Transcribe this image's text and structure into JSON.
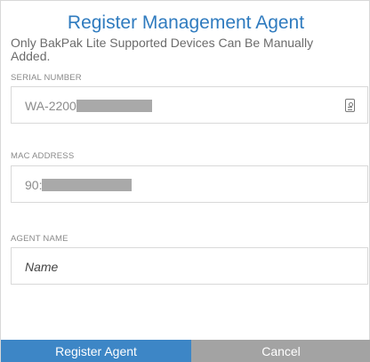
{
  "dialog": {
    "title": "Register Management Agent",
    "subtitle": "Only BakPak Lite Supported Devices Can Be Manually Added."
  },
  "fields": {
    "serial": {
      "label": "SERIAL NUMBER",
      "value": "WA-2200"
    },
    "mac": {
      "label": "MAC ADDRESS",
      "value": "90:"
    },
    "agent_name": {
      "label": "AGENT NAME",
      "placeholder": "Name"
    }
  },
  "buttons": {
    "register": "Register Agent",
    "cancel": "Cancel"
  },
  "icons": {
    "serial_field_icon": "id-card-icon"
  },
  "colors": {
    "title": "#2f7bbf",
    "primary_button": "#3d86c6",
    "cancel_button": "#a3a3a3"
  }
}
